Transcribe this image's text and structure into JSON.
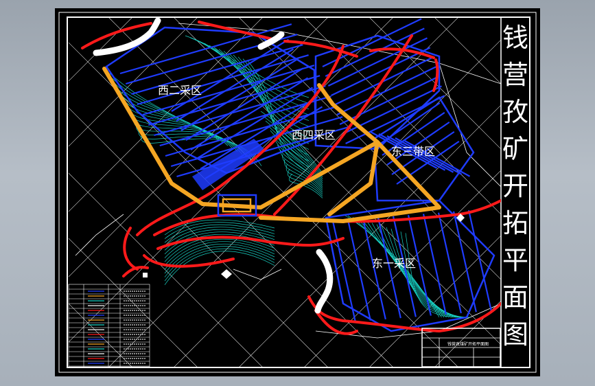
{
  "drawing": {
    "title_chars": [
      "钱",
      "营",
      "孜",
      "矿",
      "开",
      "拓",
      "平",
      "面",
      "图"
    ],
    "zones": [
      {
        "id": "west2",
        "label": "西二采区"
      },
      {
        "id": "west4",
        "label": "西四采区"
      },
      {
        "id": "east3",
        "label": "东三带区"
      },
      {
        "id": "east1",
        "label": "东一采区"
      }
    ],
    "title_block": {
      "caption": "钱营孜煤矿开拓平面图"
    },
    "colors": {
      "background": "#000000",
      "frame": "#ffffff",
      "main_roadway": "#f5a623",
      "working_face": "#1f3cff",
      "fault": "#ff1a1a",
      "contour": "#19d3c5",
      "title_text": "#ffffff"
    }
  }
}
